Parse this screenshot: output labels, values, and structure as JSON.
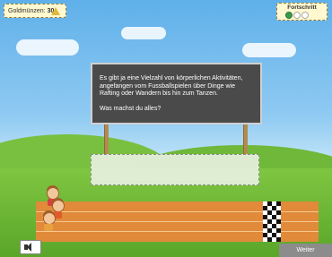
{
  "hud": {
    "coins_label": "Goldmünzen:",
    "coins_value": "30",
    "progress_label": "Fortschritt",
    "progress_dots": [
      true,
      false,
      false
    ]
  },
  "board": {
    "text": "Es gibt ja eine Vielzahl von körperlichen Aktivitäten, angefangen vom Fussballspielen über Dinge wie Rafting oder Wandern bis hin zum Tanzen.",
    "question": "Was machst du alles?"
  },
  "footer": {
    "next_label": "Weiter"
  },
  "colors": {
    "track": "#e08a3a",
    "board": "#4a4a4a",
    "progress_done": "#3a9a4a"
  }
}
